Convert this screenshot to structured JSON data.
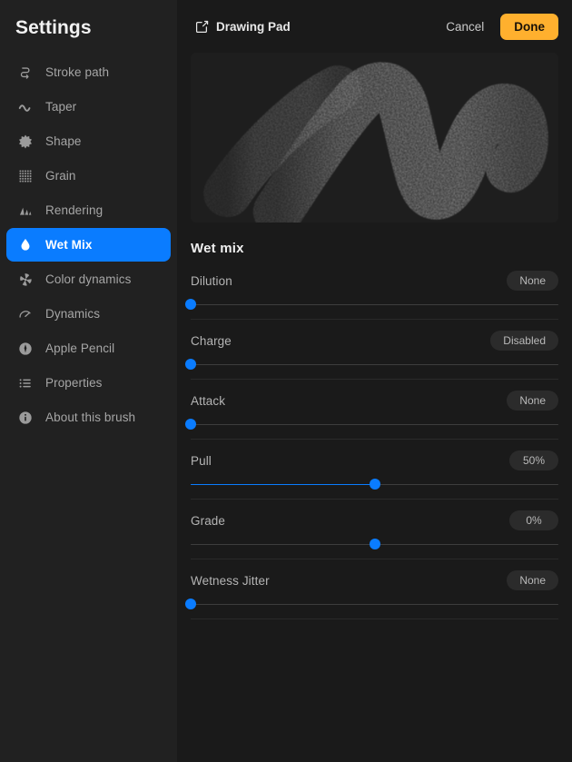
{
  "sidebar": {
    "title": "Settings",
    "items": [
      {
        "label": "Stroke path",
        "icon": "stroke-path-icon",
        "selected": false
      },
      {
        "label": "Taper",
        "icon": "taper-wave-icon",
        "selected": false
      },
      {
        "label": "Shape",
        "icon": "shape-starburst-icon",
        "selected": false
      },
      {
        "label": "Grain",
        "icon": "grain-dots-icon",
        "selected": false
      },
      {
        "label": "Rendering",
        "icon": "rendering-bars-icon",
        "selected": false
      },
      {
        "label": "Wet Mix",
        "icon": "water-drop-icon",
        "selected": true
      },
      {
        "label": "Color dynamics",
        "icon": "color-dynamics-icon",
        "selected": false
      },
      {
        "label": "Dynamics",
        "icon": "dynamics-gauge-icon",
        "selected": false
      },
      {
        "label": "Apple Pencil",
        "icon": "apple-pencil-icon",
        "selected": false
      },
      {
        "label": "Properties",
        "icon": "list-lines-icon",
        "selected": false
      },
      {
        "label": "About this brush",
        "icon": "info-circle-icon",
        "selected": false
      }
    ]
  },
  "header": {
    "drawing_pad_label": "Drawing Pad",
    "drawing_pad_icon": "compose-pencil-icon",
    "cancel_label": "Cancel",
    "done_label": "Done"
  },
  "preview": {
    "alt": "brush stroke preview"
  },
  "settings": {
    "section_title": "Wet mix",
    "rows": [
      {
        "label": "Dilution",
        "value": "None",
        "percent": 0,
        "fill": true,
        "centered": false
      },
      {
        "label": "Charge",
        "value": "Disabled",
        "percent": 0,
        "fill": true,
        "centered": false
      },
      {
        "label": "Attack",
        "value": "None",
        "percent": 0,
        "fill": true,
        "centered": false
      },
      {
        "label": "Pull",
        "value": "50%",
        "percent": 50,
        "fill": true,
        "centered": false
      },
      {
        "label": "Grade",
        "value": "0%",
        "percent": 50,
        "fill": false,
        "centered": true
      },
      {
        "label": "Wetness Jitter",
        "value": "None",
        "percent": 0,
        "fill": true,
        "centered": false
      }
    ]
  },
  "colors": {
    "accent_blue": "#0A7CFF",
    "done_amber": "#FFB02E",
    "sidebar_bg": "#212121",
    "main_bg": "#1a1a1a",
    "pill_bg": "#2b2b2b"
  }
}
